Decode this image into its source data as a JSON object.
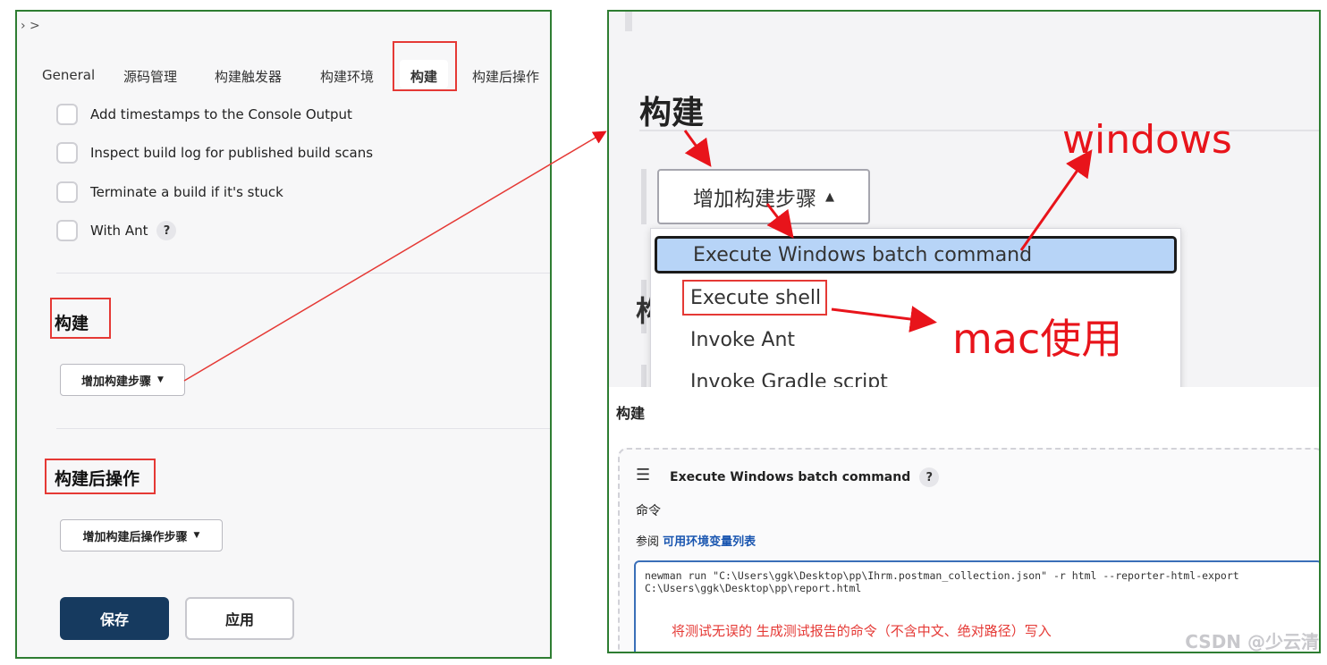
{
  "left": {
    "breadcrumb": "› >",
    "tabs": [
      "General",
      "源码管理",
      "构建触发器",
      "构建环境",
      "构建",
      "构建后操作"
    ],
    "checkboxes": [
      {
        "label": "Add timestamps to the Console Output"
      },
      {
        "label": "Inspect build log for published build scans"
      },
      {
        "label": "Terminate a build if it's stuck"
      },
      {
        "label": "With Ant"
      }
    ],
    "help_symbol": "?",
    "build_section_title": "构建",
    "add_build_step": "增加构建步骤",
    "post_build_title": "构建后操作",
    "add_post_build_step": "增加构建后操作步骤",
    "save": "保存",
    "apply": "应用"
  },
  "right_top": {
    "title": "构建",
    "add_build_step": "增加构建步骤",
    "menu_items": [
      "Execute Windows batch command",
      "Execute shell",
      "Invoke Ant",
      "Invoke Gradle script"
    ],
    "annotation_windows": "windows",
    "annotation_mac": "mac使用",
    "side_char": "构"
  },
  "right_bottom": {
    "title": "构建",
    "step_title": "Execute Windows batch command",
    "help_symbol": "?",
    "command_label": "命令",
    "ref_prefix": "参阅",
    "ref_link": "可用环境变量列表",
    "command_line1": "newman run \"C:\\Users\\ggk\\Desktop\\pp\\Ihrm.postman_collection.json\" -r html --reporter-html-export",
    "command_line2": "C:\\Users\\ggk\\Desktop\\pp\\report.html",
    "note": "将测试无误的 生成测试报告的命令（不含中文、绝对路径）写入",
    "watermark": "CSDN @少云清"
  },
  "colors": {
    "frame": "#2e7d32",
    "highlight": "#e53935",
    "save_button": "#163a5f",
    "menu_selected": "#b7d4f7",
    "annotation": "#e8141b"
  }
}
